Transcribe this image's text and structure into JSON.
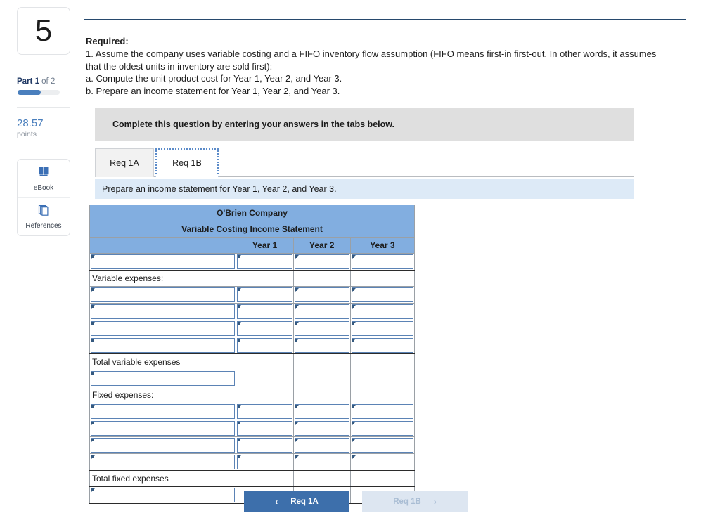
{
  "sidebar": {
    "question_number": "5",
    "part_strong": "Part 1",
    "part_rest": " of 2",
    "progress_percent": 55,
    "points_value": "28.57",
    "points_label": "points",
    "tools": [
      {
        "label": "eBook",
        "icon": "book-icon"
      },
      {
        "label": "References",
        "icon": "references-icon"
      }
    ]
  },
  "question": {
    "required_title": "Required:",
    "lines": [
      "1. Assume the company uses variable costing and a FIFO inventory flow assumption (FIFO means first-in first-out. In other words, it assumes that the oldest units in inventory are sold first):",
      "a. Compute the unit product cost for Year 1, Year 2, and Year 3.",
      "b. Prepare an income statement for Year 1, Year 2, and Year 3."
    ]
  },
  "instruction_bar": {
    "text": "Complete this question by entering your answers in the tabs below."
  },
  "tabs": [
    {
      "label": "Req 1A",
      "active": false
    },
    {
      "label": "Req 1B",
      "active": true
    }
  ],
  "tab_description": {
    "text": "Prepare an income statement for Year 1, Year 2, and Year 3."
  },
  "worksheet": {
    "title": "O'Brien Company",
    "subtitle": "Variable Costing Income Statement",
    "column_headers": [
      "",
      "Year 1",
      "Year 2",
      "Year 3"
    ],
    "rows": [
      {
        "label": "",
        "label_editable": true,
        "year_cells": "input"
      },
      {
        "label": "Variable expenses:",
        "label_editable": false,
        "year_cells": "blank"
      },
      {
        "label": "",
        "label_editable": true,
        "year_cells": "input"
      },
      {
        "label": "",
        "label_editable": true,
        "year_cells": "input"
      },
      {
        "label": "",
        "label_editable": true,
        "year_cells": "input"
      },
      {
        "label": "",
        "label_editable": true,
        "year_cells": "input"
      },
      {
        "label": "Total variable expenses",
        "label_editable": false,
        "year_cells": "blank"
      },
      {
        "label": "",
        "label_editable": true,
        "year_cells": "blank"
      },
      {
        "label": "Fixed expenses:",
        "label_editable": false,
        "year_cells": "blank"
      },
      {
        "label": "",
        "label_editable": true,
        "year_cells": "input"
      },
      {
        "label": "",
        "label_editable": true,
        "year_cells": "input"
      },
      {
        "label": "",
        "label_editable": true,
        "year_cells": "input"
      },
      {
        "label": "",
        "label_editable": true,
        "year_cells": "input"
      },
      {
        "label": "Total fixed expenses",
        "label_editable": false,
        "year_cells": "blank"
      },
      {
        "label": "",
        "label_editable": true,
        "year_cells": "blank"
      }
    ]
  },
  "navigation": {
    "prev_label": "Req 1A",
    "prev_chevron": "‹",
    "next_label": "Req 1B",
    "next_chevron": "›",
    "next_disabled": true
  },
  "colors": {
    "header_blue": "#82aee0",
    "banner_blue": "#ddeaf7",
    "gray_bar": "#dfdfdf",
    "accent_blue": "#3d6fab",
    "rule_navy": "#27496d"
  }
}
